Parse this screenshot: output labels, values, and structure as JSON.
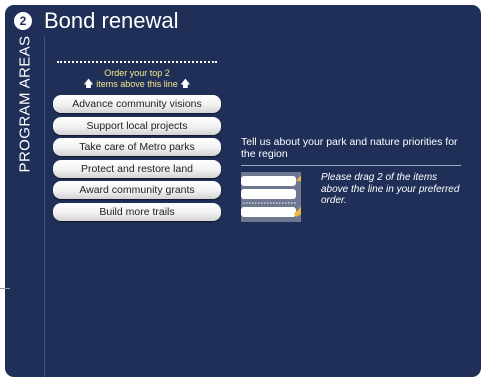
{
  "header": {
    "step_number": "2",
    "title": "Bond renewal"
  },
  "sidebar": {
    "label": "PROGRAM AREAS"
  },
  "ranking": {
    "instruction_line1": "Order your top 2",
    "instruction_line2": "items above this line",
    "arrow_glyph": "🡅",
    "items": [
      {
        "label": "Advance community visions"
      },
      {
        "label": "Support local projects"
      },
      {
        "label": "Take care of Metro parks"
      },
      {
        "label": "Protect and restore land"
      },
      {
        "label": "Award community grants"
      },
      {
        "label": "Build more trails"
      }
    ]
  },
  "prompt": {
    "question": "Tell us about your park and nature priorities for the region",
    "hint": "Please drag 2 of the items above the line in your preferred order.",
    "hint_icon": "drag-reorder-icon"
  },
  "colors": {
    "panel": "#1f2f57",
    "instruction_text": "#f3e88a",
    "arrow": "#f0b53a"
  }
}
